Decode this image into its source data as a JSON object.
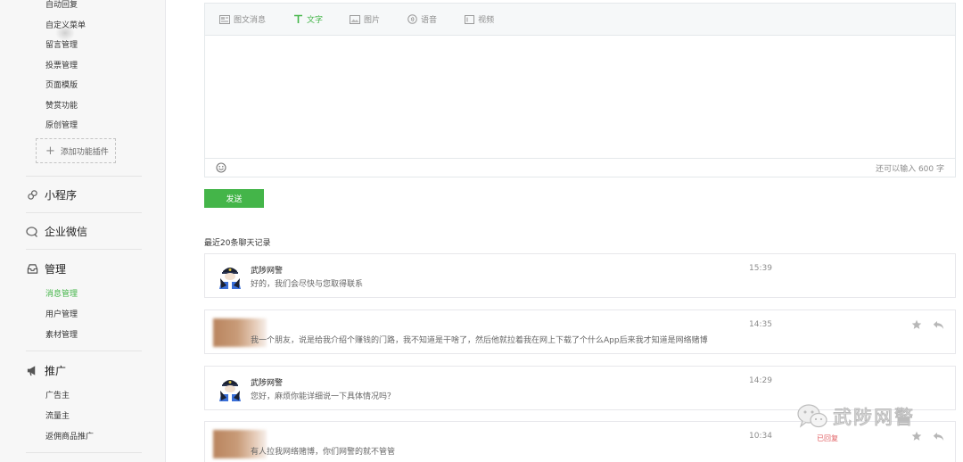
{
  "sidebar": {
    "top_items": [
      {
        "label": "自动回复"
      },
      {
        "label": "自定义菜单"
      },
      {
        "label": "留言管理"
      },
      {
        "label": "投票管理"
      },
      {
        "label": "页面模版"
      },
      {
        "label": "赞赏功能"
      },
      {
        "label": "原创管理"
      }
    ],
    "add_plugin_label": "添加功能插件",
    "sections": {
      "miniprogram": {
        "title": "小程序",
        "icon": "mini-program-icon"
      },
      "wework": {
        "title": "企业微信",
        "icon": "wework-icon"
      },
      "manage": {
        "title": "管理",
        "icon": "inbox-icon",
        "items": [
          {
            "label": "消息管理",
            "active": true
          },
          {
            "label": "用户管理"
          },
          {
            "label": "素材管理"
          }
        ]
      },
      "promote": {
        "title": "推广",
        "icon": "megaphone-icon",
        "items": [
          {
            "label": "广告主"
          },
          {
            "label": "流量主"
          },
          {
            "label": "返佣商品推广"
          }
        ]
      }
    }
  },
  "editor": {
    "tabs": [
      {
        "label": "图文消息",
        "icon": "news-icon"
      },
      {
        "label": "文字",
        "icon": "text-icon",
        "active": true
      },
      {
        "label": "图片",
        "icon": "image-icon"
      },
      {
        "label": "语音",
        "icon": "voice-icon"
      },
      {
        "label": "视频",
        "icon": "video-icon"
      }
    ],
    "emoji_icon": "emoji-icon",
    "counter": "还可以输入 600 字",
    "send_label": "发送"
  },
  "history": {
    "title": "最近20条聊天记录",
    "messages": [
      {
        "name": "武陟网警",
        "text": "好的，我们会尽快与您取得联系",
        "time": "15:39",
        "avatar": "police-avatar"
      },
      {
        "name": "",
        "text": "我一个朋友，说是给我介绍个赚钱的门路，我不知道是干啥了，然后他就拉着我在网上下载了个什么App后来我才知道是网络赌博",
        "time": "14:35",
        "avatar": "blurred-avatar"
      },
      {
        "name": "武陟网警",
        "text": "您好，麻烦你能详细说一下具体情况吗？",
        "time": "14:29",
        "avatar": "police-avatar"
      },
      {
        "name": "",
        "text": "有人拉我网络赌博，你们网警的就不管管",
        "time": "10:34",
        "avatar": "blurred-avatar",
        "status": "已回复"
      }
    ]
  },
  "watermark": {
    "text": "武陟网警"
  },
  "colors": {
    "accent": "#44b549",
    "replied": "#e15f63",
    "border": "#e7e7eb"
  }
}
